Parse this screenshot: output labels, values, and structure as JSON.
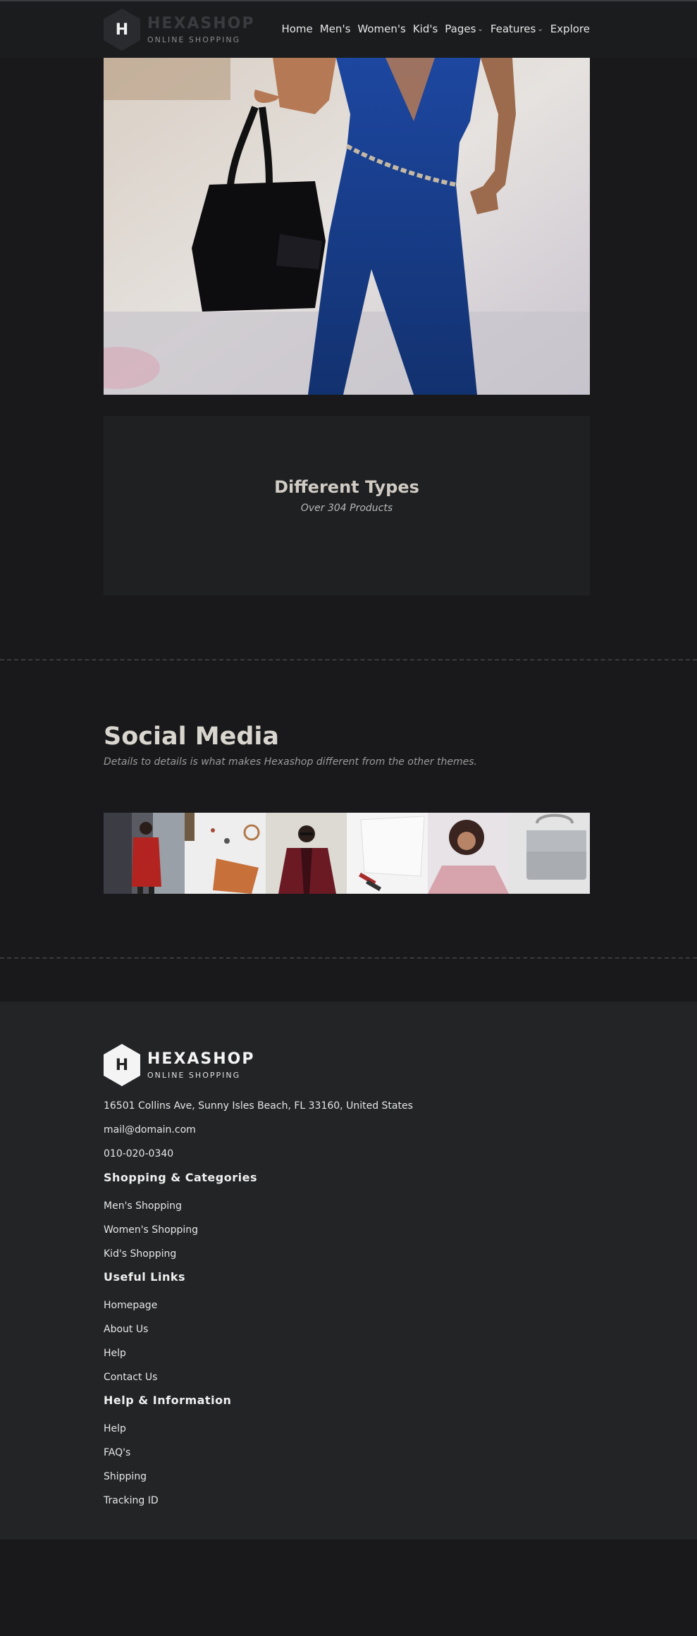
{
  "header": {
    "logo_letter": "H",
    "logo_name": "HEXASHOP",
    "logo_sub": "ONLINE SHOPPING",
    "nav": [
      {
        "label": "Home",
        "dropdown": false
      },
      {
        "label": "Men's",
        "dropdown": false
      },
      {
        "label": "Women's",
        "dropdown": false
      },
      {
        "label": "Kid's",
        "dropdown": false
      },
      {
        "label": "Pages",
        "dropdown": true
      },
      {
        "label": "Features",
        "dropdown": true
      },
      {
        "label": "Explore",
        "dropdown": false
      }
    ]
  },
  "types": {
    "title": "Different Types",
    "subtitle": "Over 304 Products"
  },
  "social": {
    "title": "Social Media",
    "subtitle": "Details to details is what makes Hexashop different from the other themes."
  },
  "footer": {
    "logo_letter": "H",
    "logo_name": "HEXASHOP",
    "logo_sub": "ONLINE SHOPPING",
    "address": "16501 Collins Ave, Sunny Isles Beach, FL 33160, United States",
    "email": "mail@domain.com",
    "phone": "010-020-0340",
    "shopping_title": "Shopping & Categories",
    "shopping_links": [
      "Men's Shopping",
      "Women's Shopping",
      "Kid's Shopping"
    ],
    "useful_title": "Useful Links",
    "useful_links": [
      "Homepage",
      "About Us",
      "Help",
      "Contact Us"
    ],
    "help_title": "Help & Information",
    "help_links": [
      "Help",
      "FAQ's",
      "Shipping",
      "Tracking ID"
    ]
  },
  "colors": {
    "background": "#19191b",
    "header": "#1b1c1e",
    "footer": "#232426",
    "card": "#1f2022",
    "jumpsuit_blue": "#1c3f8a"
  }
}
